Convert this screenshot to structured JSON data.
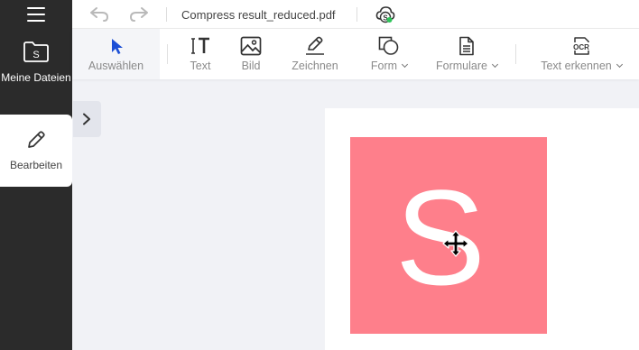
{
  "sidebar": {
    "items": [
      {
        "label": "Meine Dateien",
        "icon": "folder-s-icon"
      },
      {
        "label": "Bearbeiten",
        "icon": "pencil-icon"
      }
    ]
  },
  "topbar": {
    "filename": "Compress result_reduced.pdf"
  },
  "toolbar": {
    "tools": [
      {
        "label": "Auswählen",
        "icon": "cursor-arrow-icon",
        "active": true
      },
      {
        "label": "Text",
        "icon": "text-cursor-icon"
      },
      {
        "label": "Bild",
        "icon": "image-icon"
      },
      {
        "label": "Zeichnen",
        "icon": "pen-draw-icon"
      },
      {
        "label": "Form",
        "icon": "shapes-icon",
        "dropdown": true
      },
      {
        "label": "Formulare",
        "icon": "form-document-icon",
        "dropdown": true
      },
      {
        "label": "Text erkennen",
        "icon": "ocr-icon",
        "dropdown": true
      }
    ]
  },
  "document": {
    "logo_letter": "S"
  },
  "colors": {
    "sidebar_bg": "#2b2b2b",
    "accent_blue": "#1c4fd6",
    "logo_bg": "#fe7f8b",
    "cloud_badge": "#2ec45a",
    "canvas_bg": "#f1f2f6"
  }
}
